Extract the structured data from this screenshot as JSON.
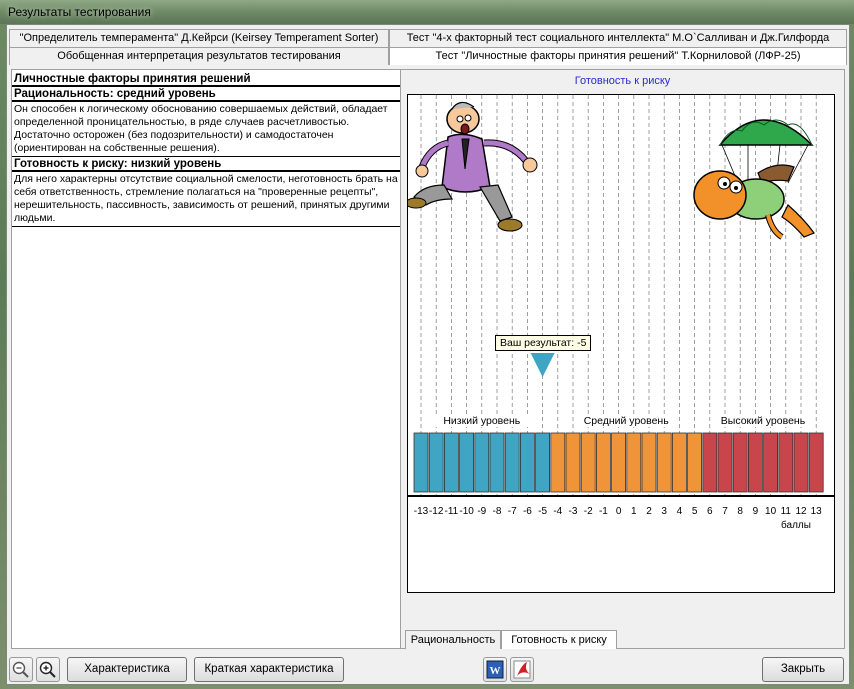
{
  "window": {
    "title": "Результаты тестирования"
  },
  "tabs_row1": [
    "\"Определитель темперамента\" Д.Кейрси (Keirsey Temperament Sorter)",
    "Тест \"4-х факторный тест социального интеллекта\" М.О`Салливан и Дж.Гилфорда"
  ],
  "tabs_row2": [
    "Обобщенная интерпретация результатов тестирования",
    "Тест \"Личностные факторы принятия решений\" Т.Корниловой (ЛФР-25)"
  ],
  "left": {
    "heading": "Личностные факторы принятия решений",
    "sections": [
      {
        "title": "Рациональность: средний уровень",
        "text": "Он способен к логическому обоснованию совершаемых действий, обладает определенной проницательностью, в ряде случаев расчетливостью. Достаточно осторожен (без подозрительности) и самодостаточен (ориентирован на собственные решения)."
      },
      {
        "title": "Готовность к риску: низкий уровень",
        "text": "Для него характерны отсутствие социальной смелости, неготовность брать на себя ответственность, стремление полагаться на \"проверенные рецепты\", нерешительность, пассивность, зависимость от решений, принятых другими людьми."
      }
    ]
  },
  "chart": {
    "title": "Готовность к риску",
    "tooltip": "Ваш результат: -5",
    "level_labels": [
      "Низкий уровень",
      "Средний уровень",
      "Высокий уровень"
    ],
    "unit_label": "баллы"
  },
  "chart_data": {
    "type": "bar",
    "title": "Готовность к риску",
    "x": [
      -13,
      -12,
      -11,
      -10,
      -9,
      -8,
      -7,
      -6,
      -5,
      -4,
      -3,
      -2,
      -1,
      0,
      1,
      2,
      3,
      4,
      5,
      6,
      7,
      8,
      9,
      10,
      11,
      12,
      13
    ],
    "levels": [
      {
        "name": "Низкий уровень",
        "from": -13,
        "to": -5,
        "color": "#3fa5c3"
      },
      {
        "name": "Средний уровень",
        "from": -4,
        "to": 5,
        "color": "#f0943a"
      },
      {
        "name": "Высокий уровень",
        "from": 6,
        "to": 13,
        "color": "#c8454b"
      }
    ],
    "result": -5,
    "xlabel": "баллы",
    "grid": true
  },
  "bottom_tabs": [
    "Рациональность",
    "Готовность к риску"
  ],
  "buttons": {
    "characteristic": "Характеристика",
    "short_characteristic": "Краткая характеристика",
    "close": "Закрыть"
  },
  "icons": {
    "zoom_out": "zoom-out-icon",
    "zoom_in": "zoom-in-icon",
    "word": "word-icon",
    "pdf": "acrobat-icon"
  }
}
